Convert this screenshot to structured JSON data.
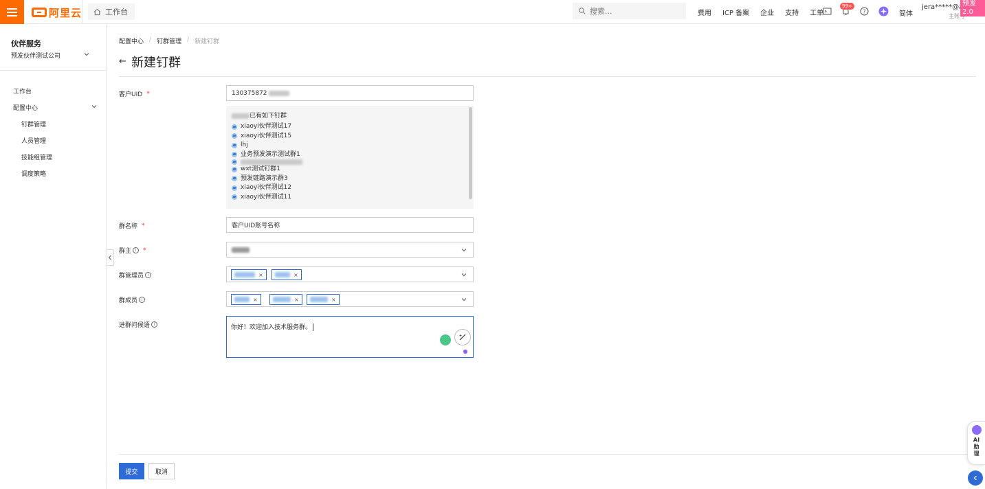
{
  "header": {
    "brand": "阿里云",
    "workbench_tab": "工作台",
    "search_placeholder": "搜索...",
    "links": [
      "费用",
      "ICP 备案",
      "企业",
      "支持",
      "工单"
    ],
    "notification_count": "99+",
    "language": "简体",
    "account_name": "jera*****@al",
    "account_type": "主账号",
    "env_tag": "预发2.0",
    "brand_color": "#ff6a00"
  },
  "sidebar": {
    "title": "伙伴服务",
    "company": "预发伙伴测试公司",
    "items": [
      {
        "label": "工作台"
      },
      {
        "label": "配置中心"
      },
      {
        "label": "钉群管理"
      },
      {
        "label": "人员管理"
      },
      {
        "label": "技能组管理"
      },
      {
        "label": "调度策略"
      }
    ]
  },
  "breadcrumb": [
    "配置中心",
    "钉群管理",
    "新建钉群"
  ],
  "page_title": "新建钉群",
  "form": {
    "customer_uid": {
      "label": "客户UID",
      "value": "130375872"
    },
    "existing_groups": {
      "header": "已有如下钉群",
      "items": [
        "xiaoyi伙伴测试17",
        "xiaoyi伙伴测试15",
        "lhj",
        "业务预发演示测试群1",
        "",
        "wxt测试钉群1",
        "预发链路演示群3",
        "xiaoyi伙伴测试12",
        "xiaoyi伙伴测试11"
      ]
    },
    "group_name": {
      "label": "群名称",
      "value": "客户UID账号名称"
    },
    "group_owner": {
      "label": "群主",
      "value": ""
    },
    "group_admins": {
      "label": "群管理员"
    },
    "group_members": {
      "label": "群成员"
    },
    "greeting": {
      "label": "进群问候语",
      "value": "你好！欢迎加入技术服务群。"
    }
  },
  "actions": {
    "submit": "提交",
    "cancel": "取消"
  },
  "ai_helper": {
    "label": "AI助理"
  },
  "accent_color": "#2f6bd7"
}
